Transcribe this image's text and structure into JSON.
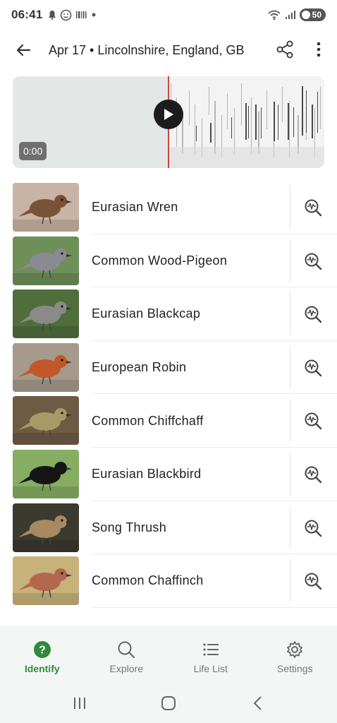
{
  "status_bar": {
    "time": "06:41",
    "battery": "50"
  },
  "header": {
    "title": "Apr 17 • Lincolnshire, England, GB"
  },
  "player": {
    "time": "0:00"
  },
  "species": [
    {
      "name": "Eurasian Wren",
      "thumb": {
        "bg": "#c9b3a4",
        "bird": "#7a5238"
      }
    },
    {
      "name": "Common Wood-Pigeon",
      "thumb": {
        "bg": "#6e8f58",
        "bird": "#8a8a92"
      }
    },
    {
      "name": "Eurasian Blackcap",
      "thumb": {
        "bg": "#4f6e3c",
        "bird": "#8a8a8a"
      }
    },
    {
      "name": "European Robin",
      "thumb": {
        "bg": "#a69a8c",
        "bird": "#c2582a"
      }
    },
    {
      "name": "Common Chiffchaff",
      "thumb": {
        "bg": "#6f5a44",
        "bird": "#a89a66"
      }
    },
    {
      "name": "Eurasian Blackbird",
      "thumb": {
        "bg": "#86ad62",
        "bird": "#151515"
      }
    },
    {
      "name": "Song Thrush",
      "thumb": {
        "bg": "#3a3a2e",
        "bird": "#a88a62"
      }
    },
    {
      "name": "Common Chaffinch",
      "thumb": {
        "bg": "#c7b27a",
        "bird": "#b2674e"
      }
    }
  ],
  "bottom_nav": [
    {
      "label": "Identify",
      "icon": "help-circle-icon",
      "active": true
    },
    {
      "label": "Explore",
      "icon": "search-icon",
      "active": false
    },
    {
      "label": "Life List",
      "icon": "list-icon",
      "active": false
    },
    {
      "label": "Settings",
      "icon": "gear-icon",
      "active": false
    }
  ],
  "colors": {
    "accent": "#2f8a3c",
    "cursor": "#c8473f"
  }
}
